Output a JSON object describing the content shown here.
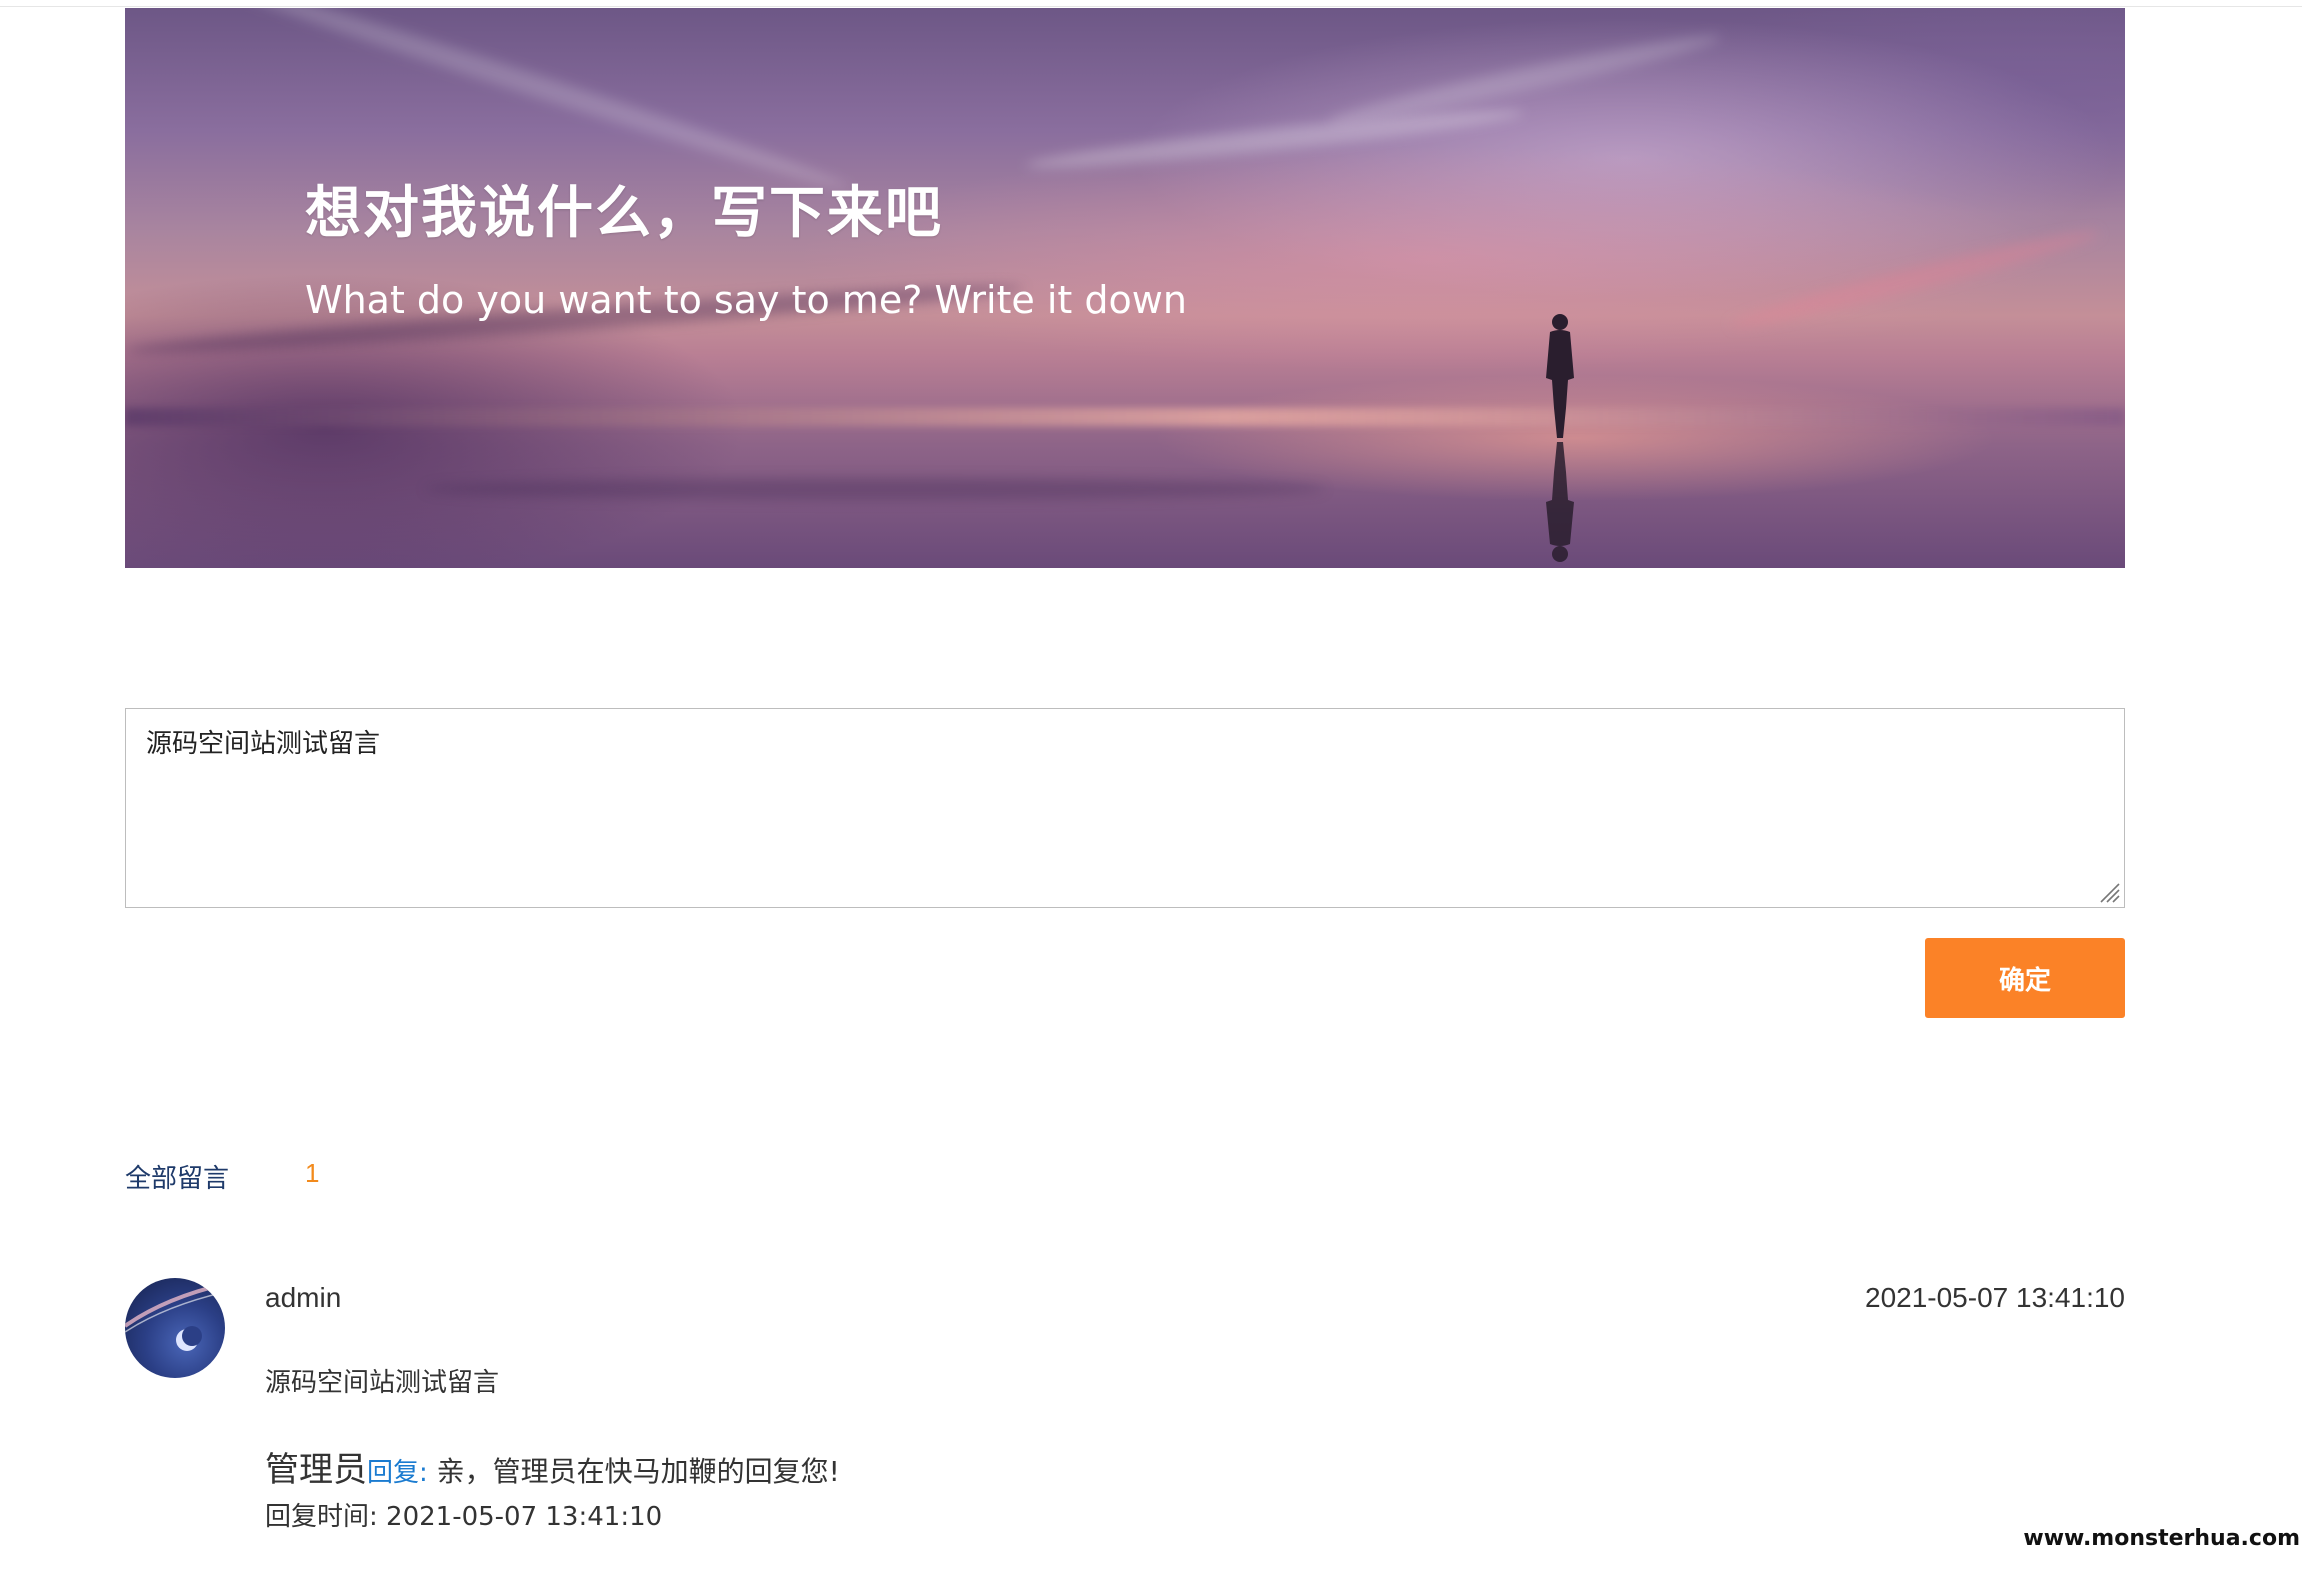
{
  "banner": {
    "title": "想对我说什么，写下来吧",
    "subtitle": "What do you want to say to me? Write it down"
  },
  "message_form": {
    "input_value": "源码空间站测试留言",
    "submit_label": "确定"
  },
  "comments_header": {
    "label": "全部留言",
    "count": "1"
  },
  "comments": [
    {
      "author": "admin",
      "time": "2021-05-07 13:41:10",
      "text": "源码空间站测试留言",
      "reply": {
        "from": "管理员",
        "label": "回复:",
        "text": " 亲，管理员在快马加鞭的回复您!",
        "time_text": "回复时间: 2021-05-07 13:41:10"
      }
    }
  ],
  "watermark": "www.monsterhua.com",
  "colors": {
    "accent": "#fb8227",
    "link": "#1a7bd0",
    "count": "#f28a1c"
  }
}
